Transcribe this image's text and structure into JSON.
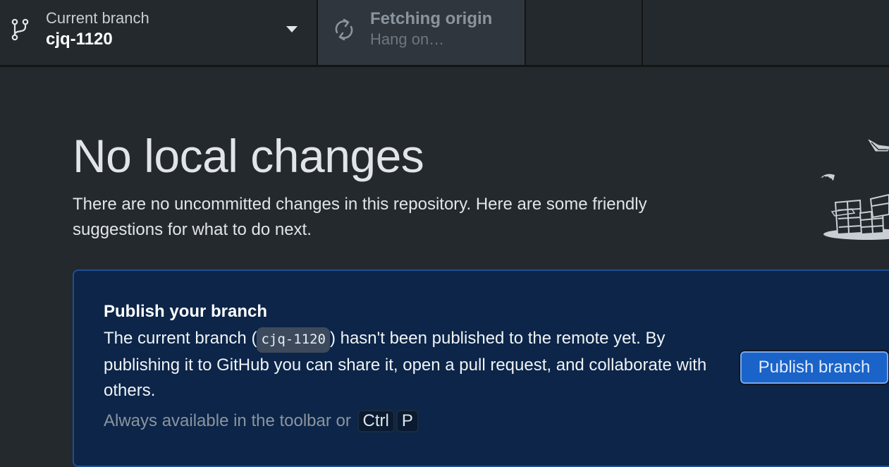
{
  "toolbar": {
    "branch": {
      "title": "Current branch",
      "value": "cjq-1120",
      "icon": "git-branch-icon"
    },
    "fetch": {
      "title": "Fetching origin",
      "subtitle": "Hang on…",
      "icon": "sync-icon"
    }
  },
  "main": {
    "title": "No local changes",
    "description": "There are no uncommitted changes in this repository. Here are some friendly suggestions for what to do next."
  },
  "publish_card": {
    "title": "Publish your branch",
    "body_before": "The current branch (",
    "branch_code": "cjq-1120",
    "body_after": ") hasn't been published to the remote yet. By publishing it to GitHub you can share it, open a pull request, and collaborate with others.",
    "hint": "Always available in the toolbar or",
    "shortcut_keys": [
      "Ctrl",
      "P"
    ],
    "button_label": "Publish branch"
  },
  "colors": {
    "background": "#24292e",
    "card_background": "#0c2548",
    "button_primary": "#1a63c9"
  }
}
